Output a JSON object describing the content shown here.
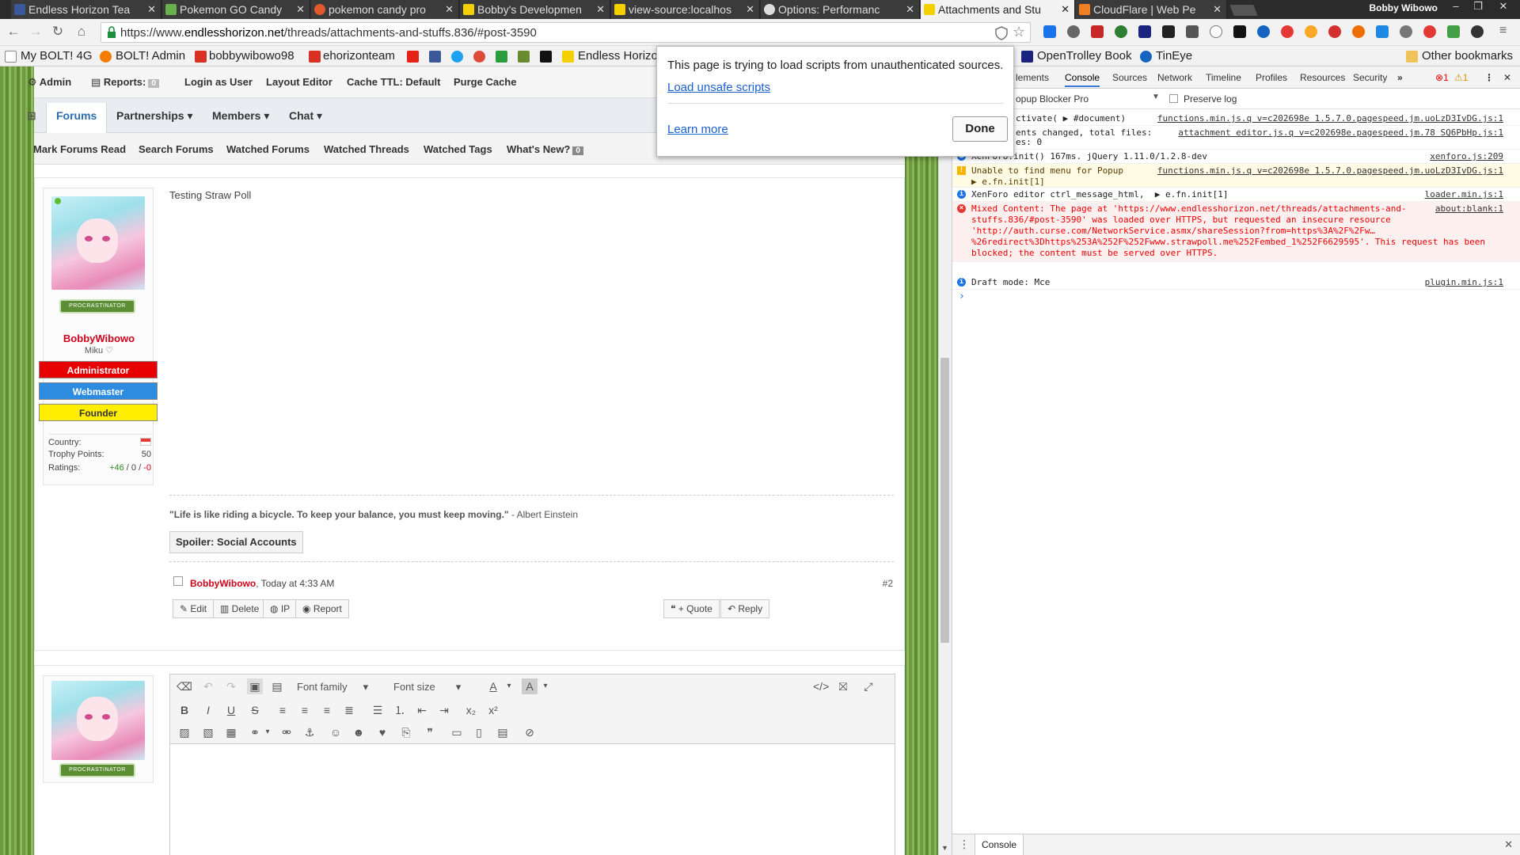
{
  "browser": {
    "tabs": [
      {
        "title": "Endless Horizon Tea",
        "color": "#3b5998"
      },
      {
        "title": "Pokemon GO Candy",
        "color": "#6ab04c"
      },
      {
        "title": "pokemon candy pro",
        "color": "#e05a2b"
      },
      {
        "title": "Bobby's Developmen",
        "color": "#f5d000"
      },
      {
        "title": "view-source:localhos",
        "color": "#f5d000"
      },
      {
        "title": "Options: Performanc",
        "color": "#dddddd"
      },
      {
        "title": "Attachments and Stu",
        "color": "#f5d000"
      },
      {
        "title": "CloudFlare | Web Pe",
        "color": "#f38020"
      }
    ],
    "profile_name": "Bobby Wibowo",
    "url_scheme": "https://www.",
    "url_host": "endlesshorizon.net",
    "url_path": "/threads/attachments-and-stuffs.836/#post-3590",
    "bookmarks": {
      "b1": "My BOLT! 4G",
      "b2": "BOLT! Admin",
      "b3": "bobbywibowo98",
      "b4": "ehorizonteam",
      "b5": "Endless Horizon",
      "b6": "OpenTrolley Book",
      "b7": "TinEye",
      "other": "Other bookmarks"
    }
  },
  "popup": {
    "text": "This page is trying to load scripts from unauthenticated sources.",
    "load_link": "Load unsafe scripts",
    "learn_more": "Learn more",
    "done": "Done"
  },
  "forum": {
    "adminbar": {
      "admin": "Admin",
      "reports": "Reports:",
      "reports_count": "0",
      "login_as_user": "Login as User",
      "layout_editor": "Layout Editor",
      "cache_ttl": "Cache TTL: Default",
      "purge_cache": "Purge Cache"
    },
    "nav": {
      "forums": "Forums",
      "partnerships": "Partnerships",
      "members": "Members",
      "chat": "Chat"
    },
    "subnav": {
      "mark_read": "Mark Forums Read",
      "search": "Search Forums",
      "watched_forums": "Watched Forums",
      "watched_threads": "Watched Threads",
      "watched_tags": "Watched Tags",
      "whats_new": "What's New?",
      "whats_new_count": "0"
    },
    "post": {
      "message": "Testing Straw Poll",
      "username": "BobbyWibowo",
      "user_title": "Miku ♡",
      "banner": "PROCRASTINATOR",
      "badges": {
        "admin": "Administrator",
        "webmaster": "Webmaster",
        "founder": "Founder"
      },
      "stats": {
        "country_label": "Country:",
        "trophy_label": "Trophy Points:",
        "trophy_value": "50",
        "ratings_label": "Ratings:",
        "ratings_pos": "+46",
        "ratings_sep1": " / ",
        "ratings_neutral": "0",
        "ratings_sep2": " / ",
        "ratings_neg": "-0"
      },
      "signature_quote": "\"Life is like riding a bicycle. To keep your balance, you must keep moving.\"",
      "signature_author": " - Albert Einstein",
      "spoiler": "Spoiler: Social Accounts",
      "author": "BobbyWibowo",
      "time": ", Today at 4:33 AM",
      "number": "#2",
      "buttons": {
        "edit": "Edit",
        "delete": "Delete",
        "ip": "IP",
        "report": "Report",
        "quote": "+ Quote",
        "reply": "Reply"
      }
    },
    "editor": {
      "font_family": "Font family",
      "font_size": "Font size"
    }
  },
  "devtools": {
    "tabs": {
      "elements": "lements",
      "console": "Console",
      "sources": "Sources",
      "network": "Network",
      "timeline": "Timeline",
      "profiles": "Profiles",
      "resources": "Resources",
      "security": "Security"
    },
    "err_count": "1",
    "warn_count": "1",
    "context": "opup Blocker Pro",
    "preserve_log": "Preserve log",
    "logs": {
      "l1_msg": "ctivate( ▶ #document)",
      "l1_src": "functions.min.js.q v=c202698e 1.5.7.0.pagespeed.jm.uoLzD3IvDG.js:1",
      "l2_msg": "ents changed, total files:",
      "l2_src": "attachment editor.js.q v=c202698e.pagespeed.jm.78 SQ6PbHp.js:1",
      "l2_msg2": "es: 0",
      "l3_msg": "XenForo.init() 167ms. jQuery 1.11.0/1.2.8-dev",
      "l3_src": "xenforo.js:209",
      "l4_msg": "Unable to find menu for Popup",
      "l4_msg2": "▶ e.fn.init[1]",
      "l4_src": "functions.min.js.q v=c202698e 1.5.7.0.pagespeed.jm.uoLzD3IvDG.js:1",
      "l5_msg": "XenForo editor ctrl_message_html,  ▶ e.fn.init[1]",
      "l5_src": "loader.min.js:1",
      "l6_a": "Mixed Content: The page at 'https://www.endlesshorizon.net/threads/attachments-and-",
      "l6_b": "stuffs.836/#post-3590' was loaded over HTTPS, but requested an insecure resource",
      "l6_c": "'http://auth.curse.com/NetworkService.asmx/shareSession?from=https%3A%2F%2Fw…",
      "l6_d": "%26redirect%3Dhttps%253A%252F%252Fwww.strawpoll.me%252Fembed_1%252F6629595'. This request has been",
      "l6_e": "blocked; the content must be served over HTTPS.",
      "l6_src": "about:blank:1",
      "l7_msg": "Draft mode: Mce",
      "l7_src": "plugin.min.js:1"
    },
    "prompt": "›",
    "drawer_tab": "Console"
  }
}
